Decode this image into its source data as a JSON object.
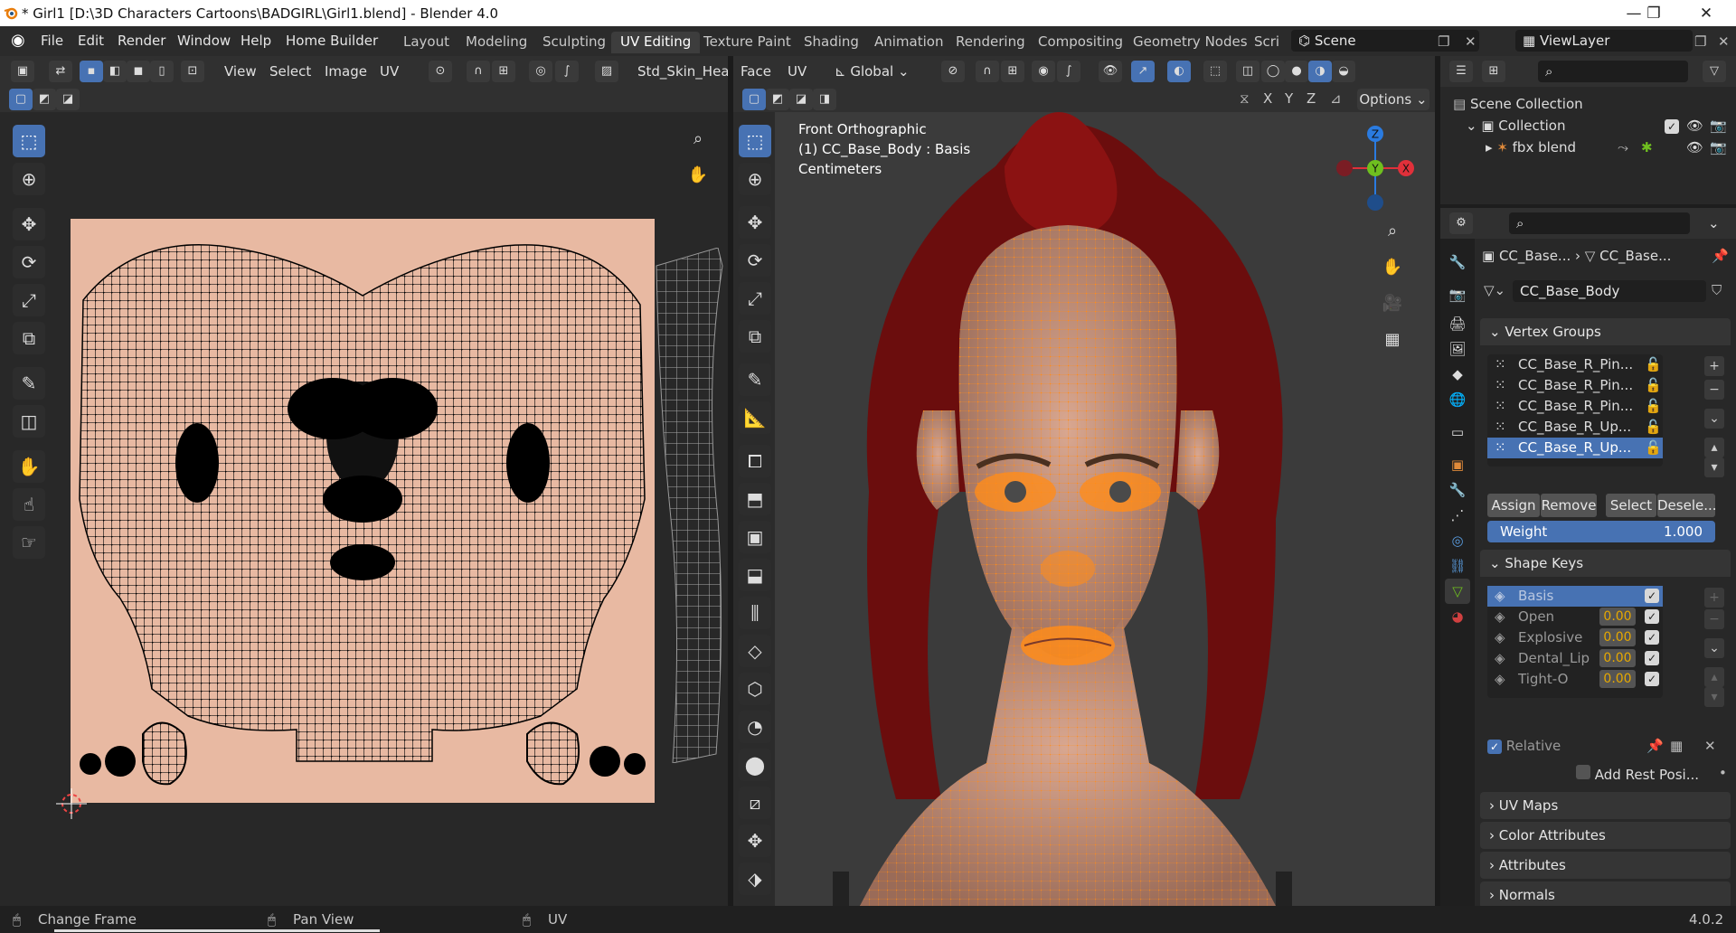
{
  "titlebar": {
    "title": "* Girl1 [D:\\3D Characters Cartoons\\BADGIRL\\Girl1.blend] - Blender 4.0",
    "min": "—",
    "max": "❐",
    "close": "✕"
  },
  "menu": [
    "File",
    "Edit",
    "Render",
    "Window",
    "Help",
    "Home Builder"
  ],
  "workspaces": [
    "Layout",
    "Modeling",
    "Sculpting",
    "UV Editing",
    "Texture Paint",
    "Shading",
    "Animation",
    "Rendering",
    "Compositing",
    "Geometry Nodes",
    "Scri"
  ],
  "scene": {
    "label": "Scene",
    "viewlayer": "ViewLayer"
  },
  "uv_header": {
    "view": "View",
    "select": "Select",
    "image": "Image",
    "uv": "UV",
    "image_name": "Std_Skin_Head"
  },
  "vp_header": {
    "face": "Face",
    "uv": "UV",
    "orientation": "Global",
    "options": "Options",
    "x": "X",
    "y": "Y",
    "z": "Z"
  },
  "vp_overlay": {
    "line1": "Front Orthographic",
    "line2": "(1) CC_Base_Body : Basis",
    "line3": "Centimeters"
  },
  "gizmo": {
    "z": "Z",
    "y": "Y",
    "x": "X"
  },
  "outliner": {
    "scene_collection": "Scene Collection",
    "collection": "Collection",
    "item": "fbx blend"
  },
  "props": {
    "breadcrumb1": "CC_Base...",
    "breadcrumb2": "CC_Base...",
    "mesh_name": "CC_Base_Body",
    "vertex_groups_title": "Vertex Groups",
    "vertex_groups": [
      "CC_Base_R_Pin...",
      "CC_Base_R_Pin...",
      "CC_Base_R_Pin...",
      "CC_Base_R_Up...",
      "CC_Base_R_Up..."
    ],
    "assign": "Assign",
    "remove": "Remove",
    "select": "Select",
    "deselect": "Desele...",
    "weight_label": "Weight",
    "weight_value": "1.000",
    "shape_keys_title": "Shape Keys",
    "shape_keys": [
      {
        "name": "Basis",
        "value": ""
      },
      {
        "name": "Open",
        "value": "0.00"
      },
      {
        "name": "Explosive",
        "value": "0.00"
      },
      {
        "name": "Dental_Lip",
        "value": "0.00"
      },
      {
        "name": "Tight-O",
        "value": "0.00"
      }
    ],
    "relative": "Relative",
    "add_rest": "Add Rest Posi...",
    "panels": [
      "UV Maps",
      "Color Attributes",
      "Attributes",
      "Normals"
    ]
  },
  "status": {
    "change_frame": "Change Frame",
    "pan_view": "Pan View",
    "uv": "UV",
    "version": "4.0.2"
  },
  "colors": {
    "accent": "#4772b3",
    "selection": "#ff8c1a",
    "skin": "#e8b9a2"
  }
}
